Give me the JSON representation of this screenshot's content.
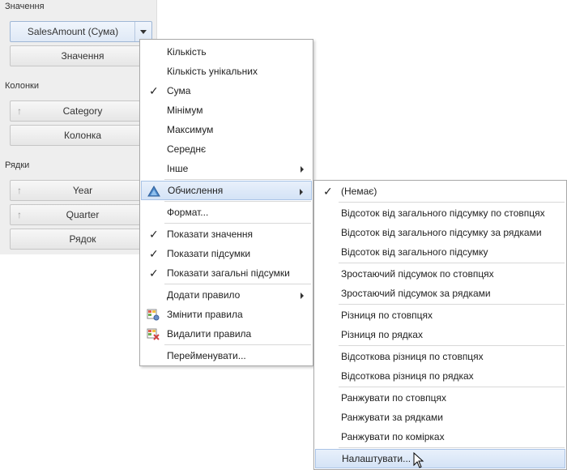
{
  "panel": {
    "values_label": "Значення",
    "values_field": "SalesAmount (Сума)",
    "values_placeholder": "Значення",
    "columns_label": "Колонки",
    "columns_field": "Category",
    "columns_placeholder": "Колонка",
    "rows_label": "Рядки",
    "rows_field1": "Year",
    "rows_field2": "Quarter",
    "rows_placeholder": "Рядок"
  },
  "menu": {
    "count": "Кількість",
    "distinct_count": "Кількість унікальних",
    "sum": "Сума",
    "min": "Мінімум",
    "max": "Максимум",
    "average": "Середнє",
    "other": "Інше",
    "calculations": "Обчислення",
    "format": "Формат...",
    "show_values": "Показати значення",
    "show_totals": "Показати підсумки",
    "show_grand_totals": "Показати загальні підсумки",
    "add_rule": "Додати правило",
    "edit_rules": "Змінити правила",
    "delete_rules": "Видалити правила",
    "rename": "Перейменувати..."
  },
  "submenu": {
    "none": "(Немає)",
    "pct_col_total": "Відсоток від загального підсумку по стовпцях",
    "pct_row_total": "Відсоток від загального підсумку за рядками",
    "pct_grand_total": "Відсоток від загального підсумку",
    "running_cols": "Зростаючий підсумок по стовпцях",
    "running_rows": "Зростаючий підсумок за рядками",
    "diff_cols": "Різниця по стовпцях",
    "diff_rows": "Різниця по рядках",
    "pct_diff_cols": "Відсоткова різниця по стовпцях",
    "pct_diff_rows": "Відсоткова різниця по рядках",
    "rank_cols": "Ранжувати по стовпцях",
    "rank_rows": "Ранжувати за рядками",
    "rank_cells": "Ранжувати по комірках",
    "customize": "Налаштувати..."
  },
  "colors": {
    "highlight": "#d4e3f6",
    "highlight_border": "#a9c3e6",
    "panel_bg": "#eeeeee"
  }
}
